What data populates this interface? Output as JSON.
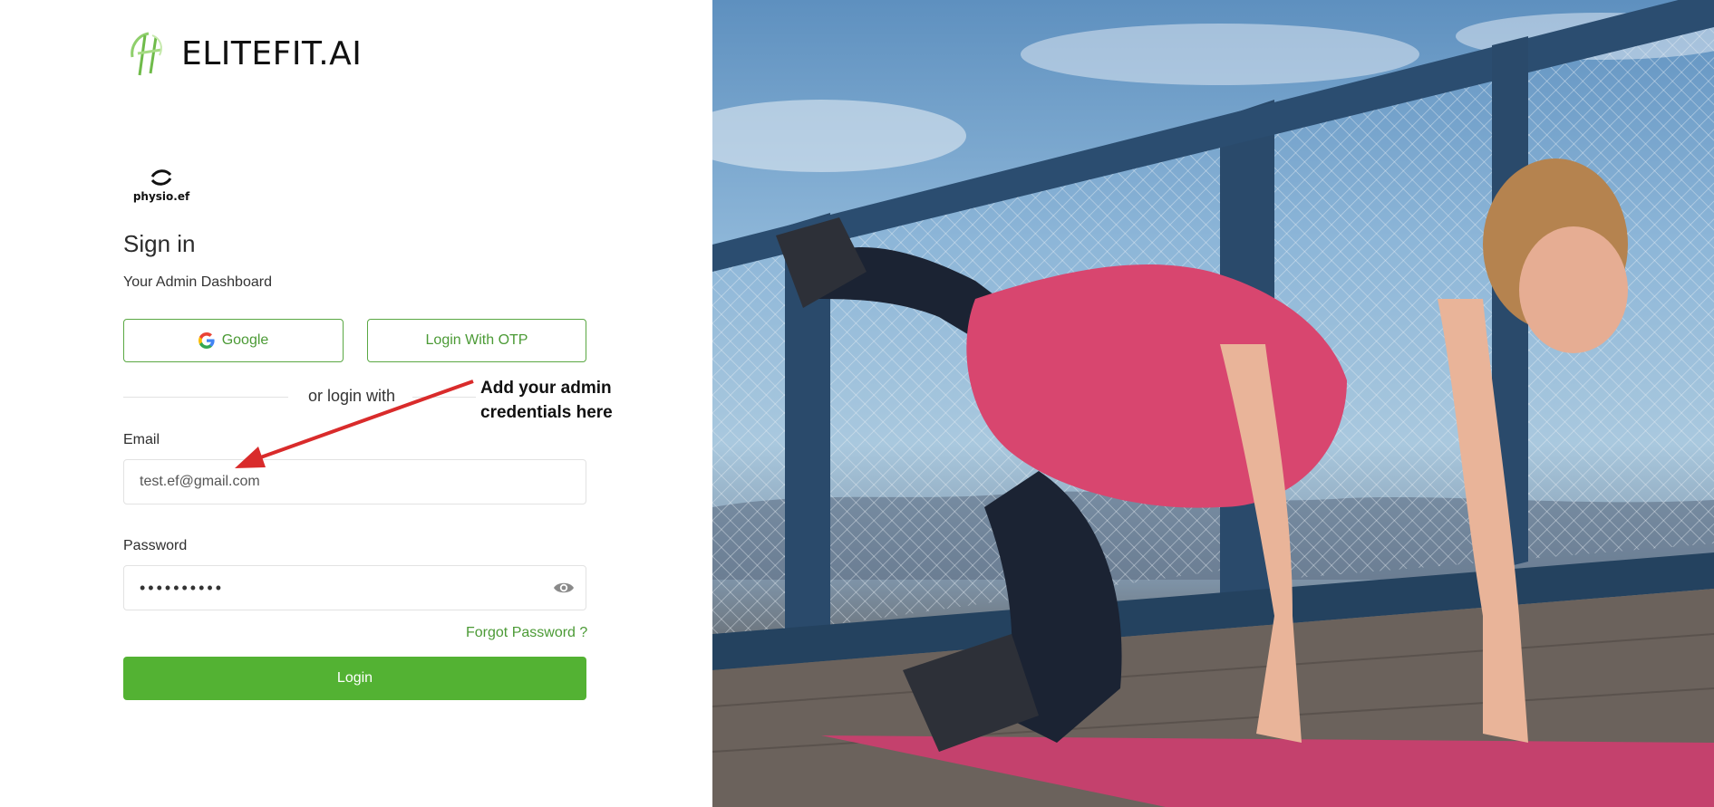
{
  "brand": {
    "name": "ELITEFIT.AI"
  },
  "sublogo": {
    "text": "physio.ef"
  },
  "signin": {
    "title": "Sign in",
    "subtitle": "Your Admin Dashboard",
    "google_label": "Google",
    "otp_label": "Login With OTP",
    "divider_text": "or login with"
  },
  "annotation": {
    "line1": "Add your admin",
    "line2": "credentials here"
  },
  "form": {
    "email_label": "Email",
    "email_value": "test.ef@gmail.com",
    "password_label": "Password",
    "password_masked": "••••••••••",
    "forgot_label": "Forgot Password ?",
    "login_label": "Login"
  },
  "colors": {
    "accent": "#53b233",
    "accent_text": "#4b9a35",
    "annotation_arrow": "#d92b2b",
    "shirt": "#d8466f",
    "mat": "#c4416d"
  },
  "icons": [
    "brand-logo-icon",
    "physio-logo-icon",
    "google-icon",
    "eye-icon"
  ]
}
